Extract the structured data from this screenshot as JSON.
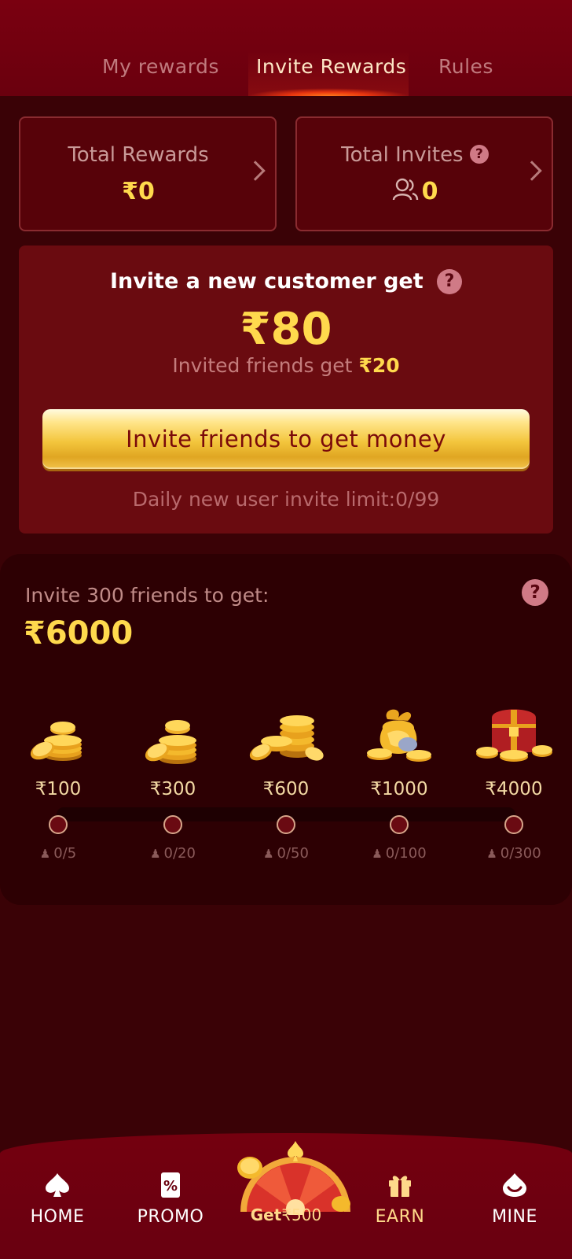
{
  "tabs": [
    {
      "label": "My rewards",
      "active": false
    },
    {
      "label": "Invite Rewards",
      "active": true
    },
    {
      "label": "Rules",
      "active": false
    }
  ],
  "summary": {
    "total_rewards_label": "Total Rewards",
    "total_rewards_value": "₹0",
    "total_invites_label": "Total Invites",
    "total_invites_value": "0",
    "help_glyph": "?"
  },
  "invite": {
    "title": "Invite a new customer get",
    "amount": "₹80",
    "sub_prefix": "Invited friends get",
    "sub_amount": "₹20",
    "button_label": "Invite friends to get money",
    "limit_text": "Daily new user invite limit:0/99"
  },
  "milestones": {
    "title": "Invite 300 friends to get:",
    "amount": "₹6000",
    "tiers": [
      {
        "value": "₹100",
        "count": "0/5",
        "icon": "coin-stack-small-icon"
      },
      {
        "value": "₹300",
        "count": "0/20",
        "icon": "coin-stack-icon"
      },
      {
        "value": "₹600",
        "count": "0/50",
        "icon": "coin-pile-icon"
      },
      {
        "value": "₹1000",
        "count": "0/100",
        "icon": "coin-bag-icon"
      },
      {
        "value": "₹4000",
        "count": "0/300",
        "icon": "treasure-chest-icon"
      }
    ],
    "progress": 0
  },
  "nav": {
    "home": "HOME",
    "promo": "PROMO",
    "get_prefix": "Get",
    "get_amount": "₹500",
    "earn": "EARN",
    "mine": "MINE"
  },
  "colors": {
    "background": "#3a0206",
    "accent_gold": "#ffd94d",
    "header_red": "#7a0010"
  }
}
